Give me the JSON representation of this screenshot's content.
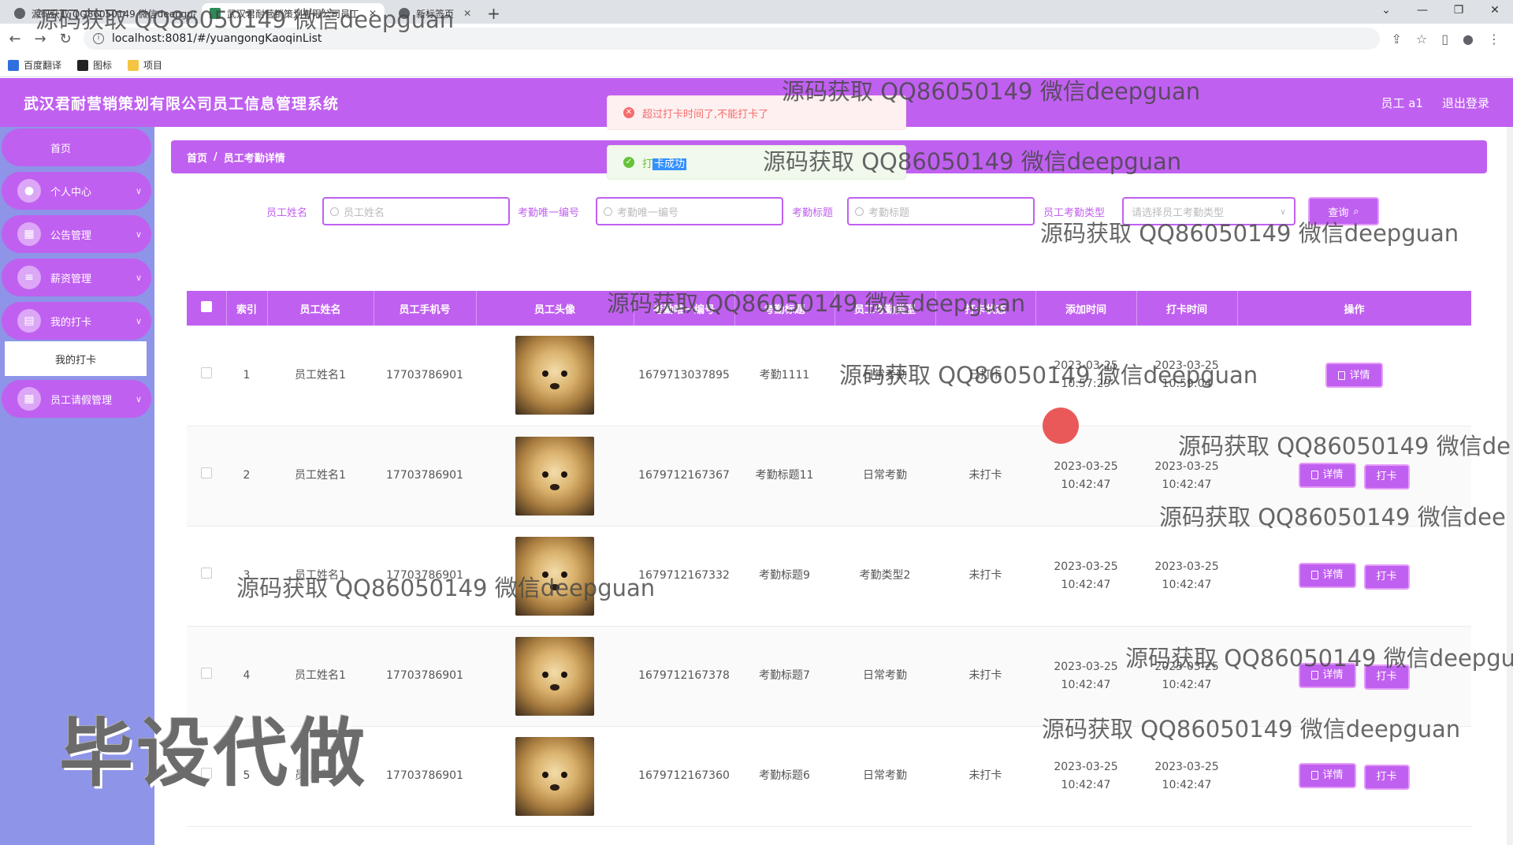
{
  "browser": {
    "tabs": [
      {
        "label": "源码获取 QQ86050149 微信deepguan"
      },
      {
        "label": "武汉君耐营销策划有限公司员工"
      },
      {
        "label": "新标签页"
      }
    ],
    "new_tab": "+",
    "url": "localhost:8081/#/yuangongKaoqinList",
    "bookmarks": [
      {
        "label": "百度翻译"
      },
      {
        "label": "图标"
      },
      {
        "label": "项目"
      }
    ]
  },
  "header": {
    "title": "武汉君耐营销策划有限公司员工信息管理系统",
    "user": "员工 a1",
    "logout": "退出登录"
  },
  "sidebar": {
    "items": [
      {
        "label": "首页"
      },
      {
        "label": "个人中心"
      },
      {
        "label": "公告管理"
      },
      {
        "label": "薪资管理"
      },
      {
        "label": "我的打卡"
      },
      {
        "label": "员工请假管理"
      }
    ],
    "sub_item": "我的打卡"
  },
  "breadcrumb": {
    "home": "首页",
    "sep": "/",
    "current": "员工考勤详情"
  },
  "search": {
    "name_label": "员工姓名",
    "name_placeholder": "员工姓名",
    "uid_label": "考勤唯一编号",
    "uid_placeholder": "考勤唯一编号",
    "title_label": "考勤标题",
    "title_placeholder": "考勤标题",
    "type_label": "员工考勤类型",
    "type_placeholder": "请选择员工考勤类型",
    "query_button": "查询"
  },
  "toasts": {
    "error": "超过打卡时间了,不能打卡了",
    "success_prefix": "打",
    "success_highlight": "卡成功"
  },
  "table": {
    "headers": [
      "索引",
      "员工姓名",
      "员工手机号",
      "员工头像",
      "考勤唯一编号",
      "考勤标题",
      "员工考勤类型",
      "打卡状态",
      "添加时间",
      "打卡时间",
      "操作"
    ],
    "detail_label": "详情",
    "punch_label": "打卡",
    "rows": [
      {
        "idx": "1",
        "name": "员工姓名1",
        "phone": "17703786901",
        "uid": "1679713037895",
        "title": "考勤1111",
        "type": "日常考勤",
        "status": "已打卡",
        "added": "2023-03-25 10:57:29",
        "punched": "2023-03-25 10:59:04",
        "can_punch": false
      },
      {
        "idx": "2",
        "name": "员工姓名1",
        "phone": "17703786901",
        "uid": "1679712167367",
        "title": "考勤标题11",
        "type": "日常考勤",
        "status": "未打卡",
        "added": "2023-03-25 10:42:47",
        "punched": "2023-03-25 10:42:47",
        "can_punch": true
      },
      {
        "idx": "3",
        "name": "员工姓名1",
        "phone": "17703786901",
        "uid": "1679712167332",
        "title": "考勤标题9",
        "type": "考勤类型2",
        "status": "未打卡",
        "added": "2023-03-25 10:42:47",
        "punched": "2023-03-25 10:42:47",
        "can_punch": true
      },
      {
        "idx": "4",
        "name": "员工姓名1",
        "phone": "17703786901",
        "uid": "1679712167378",
        "title": "考勤标题7",
        "type": "日常考勤",
        "status": "未打卡",
        "added": "2023-03-25 10:42:47",
        "punched": "2023-03-25 10:42:47",
        "can_punch": true
      },
      {
        "idx": "5",
        "name": "员工姓名1",
        "phone": "17703786901",
        "uid": "1679712167360",
        "title": "考勤标题6",
        "type": "日常考勤",
        "status": "未打卡",
        "added": "2023-03-25 10:42:47",
        "punched": "2023-03-25 10:42:47",
        "can_punch": true
      }
    ]
  },
  "overlay": {
    "watermark": "源码获取 QQ86050149 微信deepguan",
    "watermark_cut1": "源码获取 QQ86050149 微信de",
    "watermark_cut2": "源码获取 QQ86050149 微信dee",
    "watermark_cut3": "源码获取 QQ86050149 微信deepgu",
    "big_text": "毕设代做"
  },
  "colors": {
    "accent": "#c060f0",
    "sidebar_bg": "#8e94e8",
    "error": "#f56c6c",
    "success": "#67c23a"
  }
}
